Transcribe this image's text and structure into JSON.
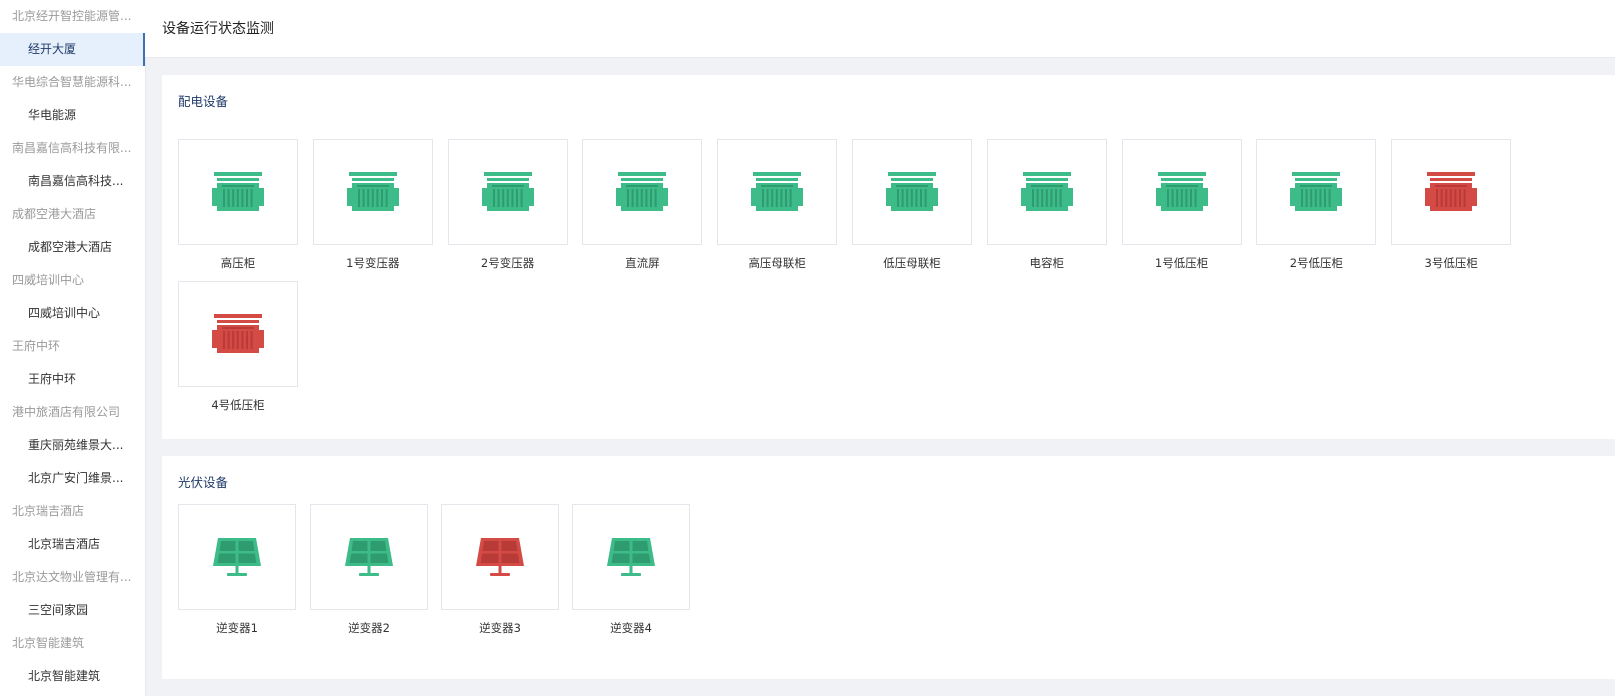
{
  "page": {
    "title": "设备运行状态监测"
  },
  "colors": {
    "normal": "#3dbb88",
    "alarm": "#d44a45",
    "normal_dark": "#2f9c6f",
    "alarm_dark": "#b93b37"
  },
  "sidebar": {
    "groups": [
      {
        "title": "北京经开智控能源管...",
        "items": [
          "经开大厦"
        ]
      },
      {
        "title": "华电综合智慧能源科...",
        "items": [
          "华电能源"
        ]
      },
      {
        "title": "南昌嘉信高科技有限...",
        "items": [
          "南昌嘉信高科技..."
        ]
      },
      {
        "title": "成都空港大酒店",
        "items": [
          "成都空港大酒店"
        ]
      },
      {
        "title": "四威培训中心",
        "items": [
          "四威培训中心"
        ]
      },
      {
        "title": "王府中环",
        "items": [
          "王府中环"
        ]
      },
      {
        "title": "港中旅酒店有限公司",
        "items": [
          "重庆丽苑维景大...",
          "北京广安门维景..."
        ]
      },
      {
        "title": "北京瑞吉酒店",
        "items": [
          "北京瑞吉酒店"
        ]
      },
      {
        "title": "北京达文物业管理有...",
        "items": [
          "三空间家园"
        ]
      },
      {
        "title": "北京智能建筑",
        "items": [
          "北京智能建筑"
        ]
      }
    ],
    "active_item": "经开大厦"
  },
  "sections": {
    "power": {
      "title": "配电设备",
      "devices": [
        {
          "name": "高压柜",
          "status": "normal",
          "icon": "cabinet-icon"
        },
        {
          "name": "1号变压器",
          "status": "normal",
          "icon": "cabinet-icon"
        },
        {
          "name": "2号变压器",
          "status": "normal",
          "icon": "cabinet-icon"
        },
        {
          "name": "直流屏",
          "status": "normal",
          "icon": "cabinet-icon"
        },
        {
          "name": "高压母联柜",
          "status": "normal",
          "icon": "cabinet-icon"
        },
        {
          "name": "低压母联柜",
          "status": "normal",
          "icon": "cabinet-icon"
        },
        {
          "name": "电容柜",
          "status": "normal",
          "icon": "cabinet-icon"
        },
        {
          "name": "1号低压柜",
          "status": "normal",
          "icon": "cabinet-icon"
        },
        {
          "name": "2号低压柜",
          "status": "normal",
          "icon": "cabinet-icon"
        },
        {
          "name": "3号低压柜",
          "status": "alarm",
          "icon": "cabinet-icon"
        },
        {
          "name": "4号低压柜",
          "status": "alarm",
          "icon": "cabinet-icon"
        }
      ]
    },
    "pv": {
      "title": "光伏设备",
      "devices": [
        {
          "name": "逆变器1",
          "status": "normal",
          "icon": "solar-panel-icon"
        },
        {
          "name": "逆变器2",
          "status": "normal",
          "icon": "solar-panel-icon"
        },
        {
          "name": "逆变器3",
          "status": "alarm",
          "icon": "solar-panel-icon"
        },
        {
          "name": "逆变器4",
          "status": "normal",
          "icon": "solar-panel-icon"
        }
      ]
    }
  }
}
